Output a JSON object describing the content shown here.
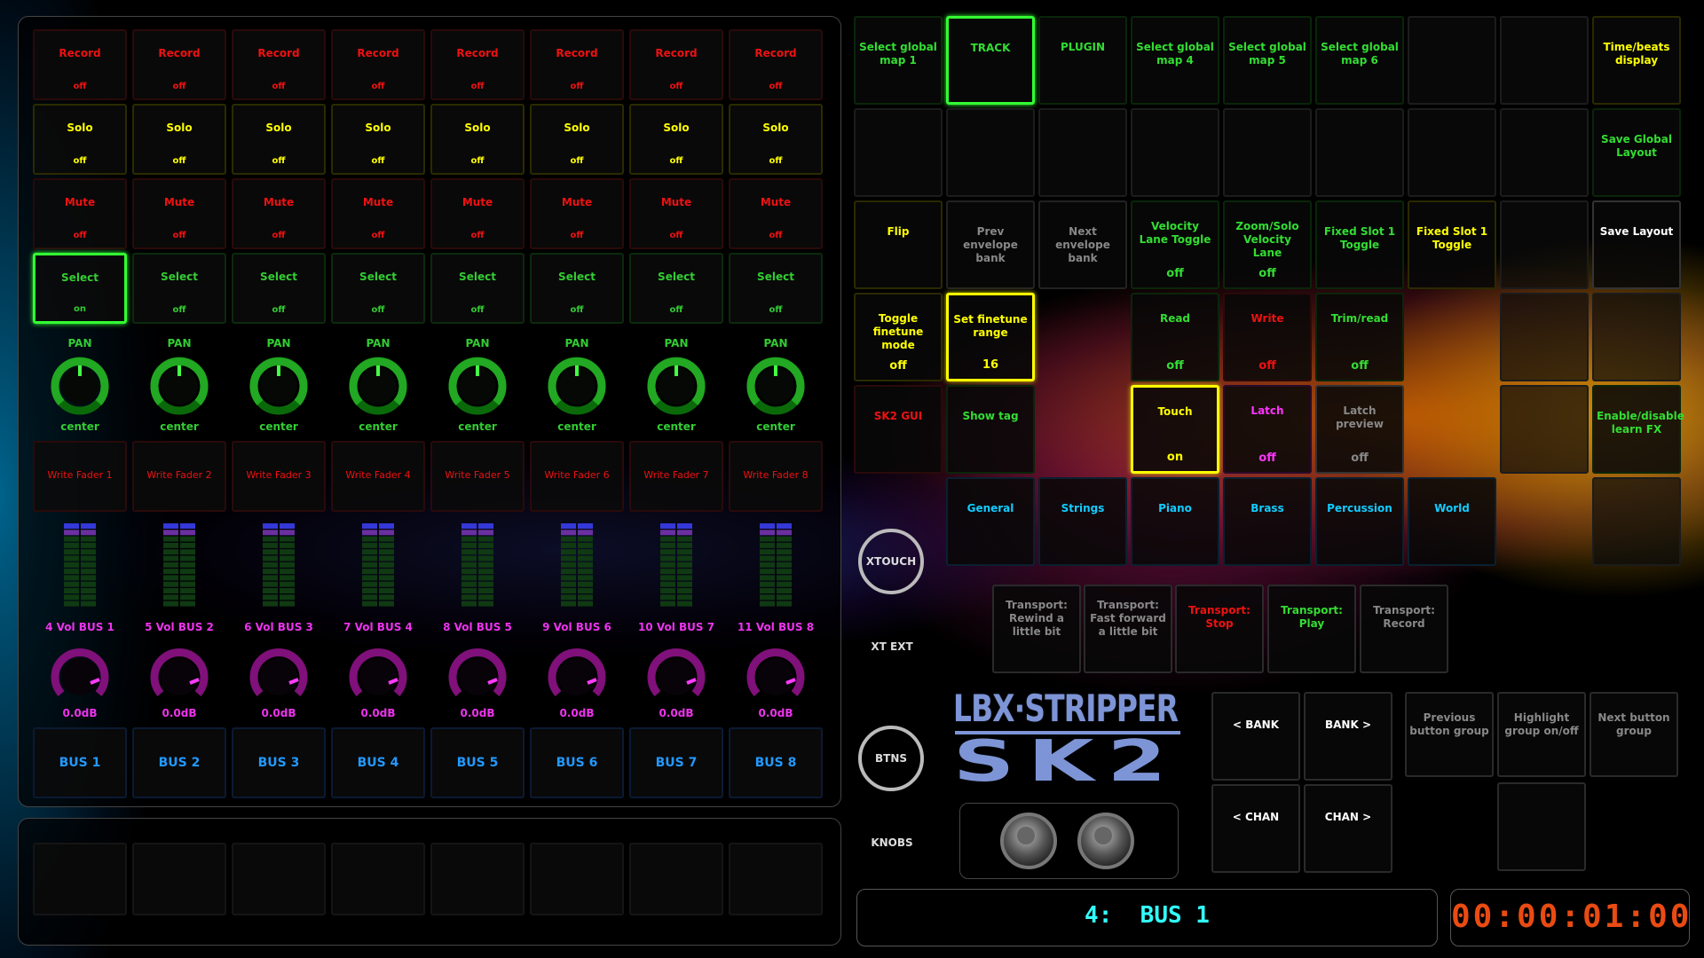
{
  "colors": {
    "record": "#e11",
    "solo": "#ff0",
    "mute": "#e11",
    "select": "#3c3",
    "pan": "#3c3",
    "vol": "#e3e",
    "bus": "#29f",
    "green": "#3d3",
    "cyan": "#1cf",
    "gray": "#888"
  },
  "strips": [
    {
      "record": "Record",
      "record_v": "off",
      "solo": "Solo",
      "solo_v": "off",
      "mute": "Mute",
      "mute_v": "off",
      "select": "Select",
      "select_v": "on",
      "pan": "PAN",
      "pan_v": "center",
      "write": "Write Fader 1",
      "vol": "4 Vol BUS 1",
      "vol_v": "0.0dB",
      "bus": "BUS 1"
    },
    {
      "record": "Record",
      "record_v": "off",
      "solo": "Solo",
      "solo_v": "off",
      "mute": "Mute",
      "mute_v": "off",
      "select": "Select",
      "select_v": "off",
      "pan": "PAN",
      "pan_v": "center",
      "write": "Write Fader 2",
      "vol": "5 Vol BUS 2",
      "vol_v": "0.0dB",
      "bus": "BUS 2"
    },
    {
      "record": "Record",
      "record_v": "off",
      "solo": "Solo",
      "solo_v": "off",
      "mute": "Mute",
      "mute_v": "off",
      "select": "Select",
      "select_v": "off",
      "pan": "PAN",
      "pan_v": "center",
      "write": "Write Fader 3",
      "vol": "6 Vol BUS 3",
      "vol_v": "0.0dB",
      "bus": "BUS 3"
    },
    {
      "record": "Record",
      "record_v": "off",
      "solo": "Solo",
      "solo_v": "off",
      "mute": "Mute",
      "mute_v": "off",
      "select": "Select",
      "select_v": "off",
      "pan": "PAN",
      "pan_v": "center",
      "write": "Write Fader 4",
      "vol": "7 Vol BUS 4",
      "vol_v": "0.0dB",
      "bus": "BUS 4"
    },
    {
      "record": "Record",
      "record_v": "off",
      "solo": "Solo",
      "solo_v": "off",
      "mute": "Mute",
      "mute_v": "off",
      "select": "Select",
      "select_v": "off",
      "pan": "PAN",
      "pan_v": "center",
      "write": "Write Fader 5",
      "vol": "8 Vol BUS 5",
      "vol_v": "0.0dB",
      "bus": "BUS 5"
    },
    {
      "record": "Record",
      "record_v": "off",
      "solo": "Solo",
      "solo_v": "off",
      "mute": "Mute",
      "mute_v": "off",
      "select": "Select",
      "select_v": "off",
      "pan": "PAN",
      "pan_v": "center",
      "write": "Write Fader 6",
      "vol": "9 Vol BUS 6",
      "vol_v": "0.0dB",
      "bus": "BUS 6"
    },
    {
      "record": "Record",
      "record_v": "off",
      "solo": "Solo",
      "solo_v": "off",
      "mute": "Mute",
      "mute_v": "off",
      "select": "Select",
      "select_v": "off",
      "pan": "PAN",
      "pan_v": "center",
      "write": "Write Fader 7",
      "vol": "10 Vol BUS 7",
      "vol_v": "0.0dB",
      "bus": "BUS 7"
    },
    {
      "record": "Record",
      "record_v": "off",
      "solo": "Solo",
      "solo_v": "off",
      "mute": "Mute",
      "mute_v": "off",
      "select": "Select",
      "select_v": "off",
      "pan": "PAN",
      "pan_v": "center",
      "write": "Write Fader 8",
      "vol": "11 Vol BUS 8",
      "vol_v": "0.0dB",
      "bus": "BUS 8"
    }
  ],
  "grid": {
    "row1": {
      "b1": "Select global map 1",
      "b2": "TRACK",
      "b3": "PLUGIN",
      "b4": "Select global map 4",
      "b5": "Select global map 5",
      "b6": "Select global map 6",
      "b9": "Time/beats display"
    },
    "row2": {
      "b9": "Save Global Layout"
    },
    "row3": {
      "b1": "Flip",
      "b2": "Prev envelope bank",
      "b3": "Next envelope bank",
      "b4": "Velocity Lane Toggle",
      "b4v": "off",
      "b5": "Zoom/Solo Velocity Lane",
      "b5v": "off",
      "b6": "Fixed Slot 1 Toggle",
      "b7": "Fixed Slot 1 Toggle",
      "b9": "Save Layout"
    },
    "row4": {
      "b1": "Toggle finetune mode",
      "b1v": "off",
      "b2": "Set finetune range",
      "b2v": "16",
      "b4": "Read",
      "b4v": "off",
      "b5": "Write",
      "b5v": "off",
      "b6": "Trim/read",
      "b6v": "off"
    },
    "row5": {
      "b1": "SK2 GUI",
      "b2": "Show tag",
      "b4": "Touch",
      "b4v": "on",
      "b5": "Latch",
      "b5v": "off",
      "b6": "Latch preview",
      "b6v": "off",
      "b9": "Enable/disable learn FX"
    },
    "row6": {
      "b2": "General",
      "b3": "Strings",
      "b4": "Piano",
      "b5": "Brass",
      "b6": "Percussion",
      "b7": "World"
    }
  },
  "modes": {
    "xtouch": "XTOUCH",
    "xtext": "XT EXT",
    "btns": "BTNS",
    "knobs": "KNOBS"
  },
  "transport": {
    "rewind": "Transport: Rewind a little bit",
    "ff": "Transport: Fast forward a little bit",
    "stop": "Transport: Stop",
    "play": "Transport: Play",
    "record": "Transport: Record"
  },
  "nav": {
    "bank_l": "< BANK",
    "bank_r": "BANK >",
    "chan_l": "< CHAN",
    "chan_r": "CHAN >",
    "prev_group": "Previous button group",
    "highlight": "Highlight group on/off",
    "next_group": "Next button group"
  },
  "logo": {
    "line1": "LBX·STRIPPER",
    "line2": "SK2"
  },
  "display": {
    "track": "4:  BUS 1",
    "time": "00:00:01:00"
  }
}
